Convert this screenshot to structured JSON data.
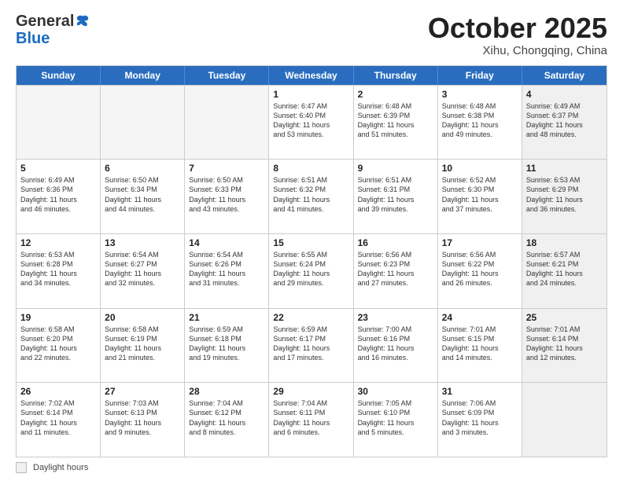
{
  "logo": {
    "general": "General",
    "blue": "Blue"
  },
  "title": "October 2025",
  "subtitle": "Xihu, Chongqing, China",
  "header_days": [
    "Sunday",
    "Monday",
    "Tuesday",
    "Wednesday",
    "Thursday",
    "Friday",
    "Saturday"
  ],
  "weeks": [
    [
      {
        "day": "",
        "detail": "",
        "empty": true
      },
      {
        "day": "",
        "detail": "",
        "empty": true
      },
      {
        "day": "",
        "detail": "",
        "empty": true
      },
      {
        "day": "1",
        "detail": "Sunrise: 6:47 AM\nSunset: 6:40 PM\nDaylight: 11 hours\nand 53 minutes."
      },
      {
        "day": "2",
        "detail": "Sunrise: 6:48 AM\nSunset: 6:39 PM\nDaylight: 11 hours\nand 51 minutes."
      },
      {
        "day": "3",
        "detail": "Sunrise: 6:48 AM\nSunset: 6:38 PM\nDaylight: 11 hours\nand 49 minutes."
      },
      {
        "day": "4",
        "detail": "Sunrise: 6:49 AM\nSunset: 6:37 PM\nDaylight: 11 hours\nand 48 minutes.",
        "shaded": true
      }
    ],
    [
      {
        "day": "5",
        "detail": "Sunrise: 6:49 AM\nSunset: 6:36 PM\nDaylight: 11 hours\nand 46 minutes."
      },
      {
        "day": "6",
        "detail": "Sunrise: 6:50 AM\nSunset: 6:34 PM\nDaylight: 11 hours\nand 44 minutes."
      },
      {
        "day": "7",
        "detail": "Sunrise: 6:50 AM\nSunset: 6:33 PM\nDaylight: 11 hours\nand 43 minutes."
      },
      {
        "day": "8",
        "detail": "Sunrise: 6:51 AM\nSunset: 6:32 PM\nDaylight: 11 hours\nand 41 minutes."
      },
      {
        "day": "9",
        "detail": "Sunrise: 6:51 AM\nSunset: 6:31 PM\nDaylight: 11 hours\nand 39 minutes."
      },
      {
        "day": "10",
        "detail": "Sunrise: 6:52 AM\nSunset: 6:30 PM\nDaylight: 11 hours\nand 37 minutes."
      },
      {
        "day": "11",
        "detail": "Sunrise: 6:53 AM\nSunset: 6:29 PM\nDaylight: 11 hours\nand 36 minutes.",
        "shaded": true
      }
    ],
    [
      {
        "day": "12",
        "detail": "Sunrise: 6:53 AM\nSunset: 6:28 PM\nDaylight: 11 hours\nand 34 minutes."
      },
      {
        "day": "13",
        "detail": "Sunrise: 6:54 AM\nSunset: 6:27 PM\nDaylight: 11 hours\nand 32 minutes."
      },
      {
        "day": "14",
        "detail": "Sunrise: 6:54 AM\nSunset: 6:26 PM\nDaylight: 11 hours\nand 31 minutes."
      },
      {
        "day": "15",
        "detail": "Sunrise: 6:55 AM\nSunset: 6:24 PM\nDaylight: 11 hours\nand 29 minutes."
      },
      {
        "day": "16",
        "detail": "Sunrise: 6:56 AM\nSunset: 6:23 PM\nDaylight: 11 hours\nand 27 minutes."
      },
      {
        "day": "17",
        "detail": "Sunrise: 6:56 AM\nSunset: 6:22 PM\nDaylight: 11 hours\nand 26 minutes."
      },
      {
        "day": "18",
        "detail": "Sunrise: 6:57 AM\nSunset: 6:21 PM\nDaylight: 11 hours\nand 24 minutes.",
        "shaded": true
      }
    ],
    [
      {
        "day": "19",
        "detail": "Sunrise: 6:58 AM\nSunset: 6:20 PM\nDaylight: 11 hours\nand 22 minutes."
      },
      {
        "day": "20",
        "detail": "Sunrise: 6:58 AM\nSunset: 6:19 PM\nDaylight: 11 hours\nand 21 minutes."
      },
      {
        "day": "21",
        "detail": "Sunrise: 6:59 AM\nSunset: 6:18 PM\nDaylight: 11 hours\nand 19 minutes."
      },
      {
        "day": "22",
        "detail": "Sunrise: 6:59 AM\nSunset: 6:17 PM\nDaylight: 11 hours\nand 17 minutes."
      },
      {
        "day": "23",
        "detail": "Sunrise: 7:00 AM\nSunset: 6:16 PM\nDaylight: 11 hours\nand 16 minutes."
      },
      {
        "day": "24",
        "detail": "Sunrise: 7:01 AM\nSunset: 6:15 PM\nDaylight: 11 hours\nand 14 minutes."
      },
      {
        "day": "25",
        "detail": "Sunrise: 7:01 AM\nSunset: 6:14 PM\nDaylight: 11 hours\nand 12 minutes.",
        "shaded": true
      }
    ],
    [
      {
        "day": "26",
        "detail": "Sunrise: 7:02 AM\nSunset: 6:14 PM\nDaylight: 11 hours\nand 11 minutes."
      },
      {
        "day": "27",
        "detail": "Sunrise: 7:03 AM\nSunset: 6:13 PM\nDaylight: 11 hours\nand 9 minutes."
      },
      {
        "day": "28",
        "detail": "Sunrise: 7:04 AM\nSunset: 6:12 PM\nDaylight: 11 hours\nand 8 minutes."
      },
      {
        "day": "29",
        "detail": "Sunrise: 7:04 AM\nSunset: 6:11 PM\nDaylight: 11 hours\nand 6 minutes."
      },
      {
        "day": "30",
        "detail": "Sunrise: 7:05 AM\nSunset: 6:10 PM\nDaylight: 11 hours\nand 5 minutes."
      },
      {
        "day": "31",
        "detail": "Sunrise: 7:06 AM\nSunset: 6:09 PM\nDaylight: 11 hours\nand 3 minutes."
      },
      {
        "day": "",
        "detail": "",
        "empty": true,
        "shaded": true
      }
    ]
  ],
  "footer": {
    "legend_label": "Daylight hours"
  }
}
